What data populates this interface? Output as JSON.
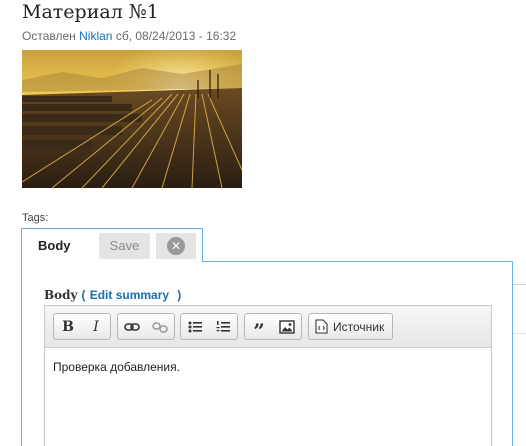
{
  "node": {
    "title": "Материал №1",
    "submitted_prefix": "Оставлен",
    "author": "Niklan",
    "date": "сб, 08/24/2013 - 16:32"
  },
  "tags_label": "Tags:",
  "edit_tab": {
    "label": "Body",
    "save_label": "Save",
    "close_icon": "close-icon"
  },
  "field": {
    "label": "Body",
    "open_paren": "(",
    "edit_summary": "Edit summary",
    "close_paren": ")"
  },
  "toolbar": {
    "bold": "B",
    "italic": "I",
    "link_icon": "link-icon",
    "unlink_icon": "unlink-icon",
    "bulleted_list_icon": "bulleted-list-icon",
    "numbered_list_icon": "numbered-list-icon",
    "blockquote_icon": "blockquote-icon",
    "image_icon": "image-icon",
    "source_label": "Источник"
  },
  "editor": {
    "content": "Проверка добавления."
  }
}
